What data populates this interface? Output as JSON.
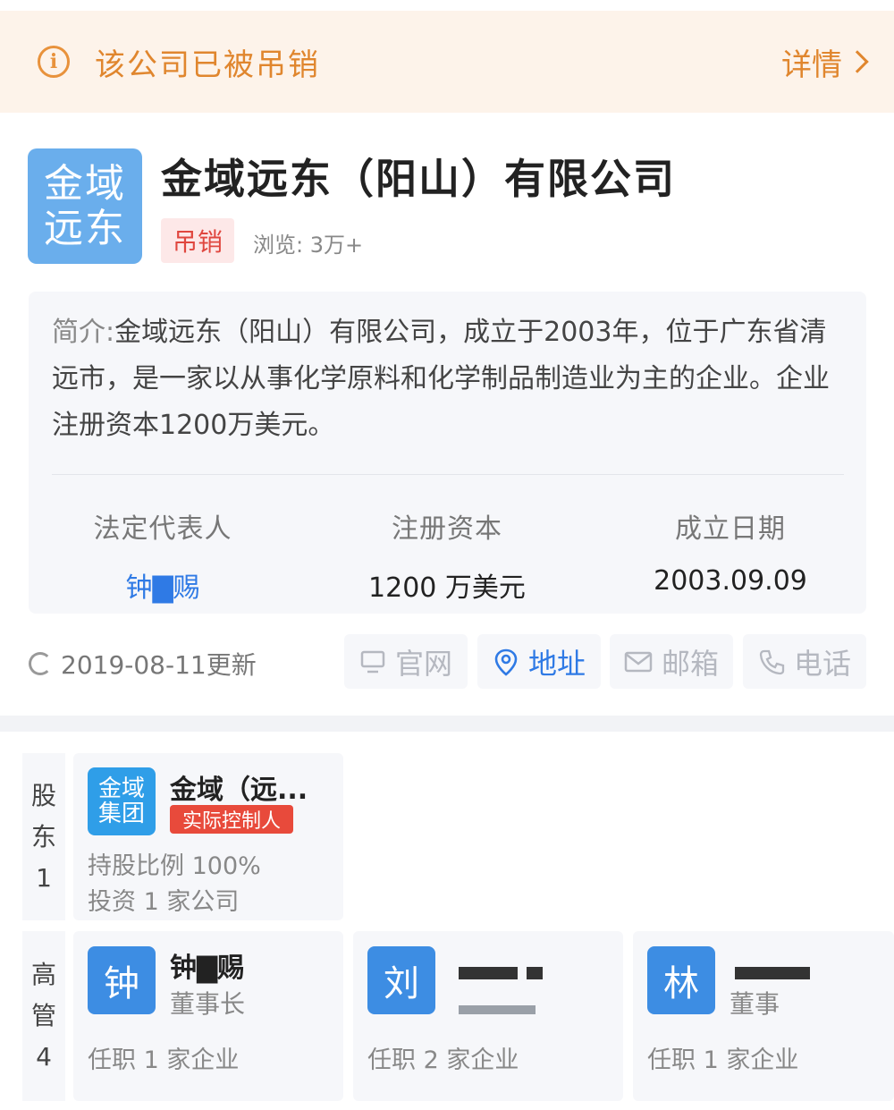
{
  "notice": {
    "text": "该公司已被吊销",
    "detail_label": "详情"
  },
  "company": {
    "logo_line1": "金域",
    "logo_line2": "远东",
    "name": "金域远东（阳山）有限公司",
    "status": "吊销",
    "views": "浏览: 3万+"
  },
  "intro": {
    "label": "简介:",
    "text": "金域远东（阳山）有限公司，成立于2003年，位于广东省清远市，是一家以从事化学原料和化学制品制造业为主的企业。企业注册资本1200万美元。"
  },
  "stats": [
    {
      "label": "法定代表人",
      "value": "钟▇赐"
    },
    {
      "label": "注册资本",
      "value": "1200 万美元"
    },
    {
      "label": "成立日期",
      "value": "2003.09.09"
    }
  ],
  "update": {
    "text": "2019-08-11更新"
  },
  "actions": [
    {
      "label": "官网",
      "icon": "monitor-icon",
      "active": false
    },
    {
      "label": "地址",
      "icon": "location-pin-icon",
      "active": true
    },
    {
      "label": "邮箱",
      "icon": "mail-icon",
      "active": false
    },
    {
      "label": "电话",
      "icon": "phone-icon",
      "active": false
    }
  ],
  "shareholders": {
    "side_label": [
      "股",
      "东",
      "1"
    ],
    "items": [
      {
        "logo_line1": "金域",
        "logo_line2": "集团",
        "name": "金域（远...",
        "tag": "实际控制人",
        "ratio": "持股比例 100%",
        "invest": "投资 1 家公司"
      }
    ]
  },
  "executives": {
    "side_label": [
      "高",
      "管",
      "4"
    ],
    "items": [
      {
        "avatar": "钟",
        "name": "钟▇赐",
        "role": "董事长",
        "posts": "任职 1 家企业"
      },
      {
        "avatar": "刘",
        "name": "",
        "role": "",
        "posts": "任职 2 家企业"
      },
      {
        "avatar": "林",
        "name": "",
        "role": "董事",
        "posts": "任职 1 家企业"
      }
    ]
  },
  "colors": {
    "accent": "#2f7ae5",
    "warning": "#e0862e",
    "danger": "#e0473f",
    "logo_blue": "#6aaeec"
  }
}
